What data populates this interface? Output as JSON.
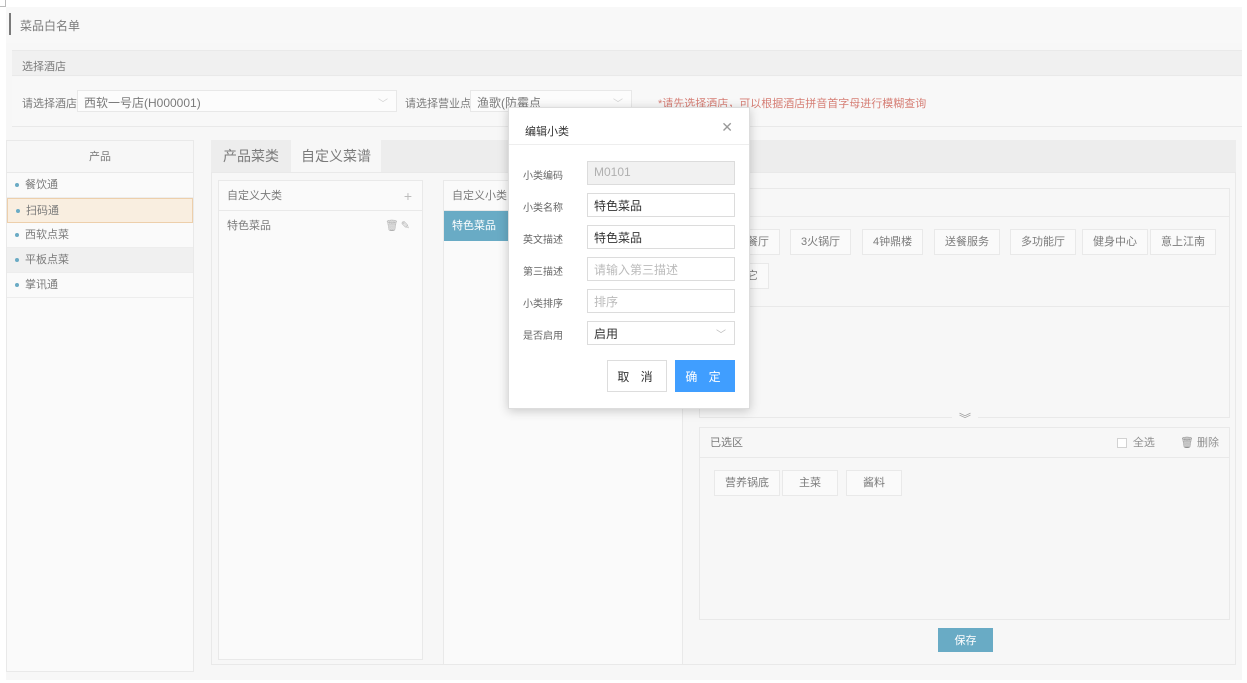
{
  "page_title": "菜品白名单",
  "section_select_hotel": "选择酒店",
  "filters": {
    "hotel_label": "请选择酒店",
    "hotel_value": "西软一号店(H000001)",
    "outlet_label": "请选择营业点",
    "outlet_value": "渔歌(防霉点",
    "hint": "*请先选择酒店，可以根据酒店拼音首字母进行模糊查询"
  },
  "left_panel": {
    "header": "产品",
    "items": [
      "餐饮通",
      "扫码通",
      "西软点菜",
      "平板点菜",
      "掌讯通"
    ]
  },
  "tabs": [
    "产品菜类",
    "自定义菜谱"
  ],
  "col1": {
    "header": "自定义大类",
    "rows": [
      "特色菜品"
    ]
  },
  "col2": {
    "header": "自定义小类",
    "selected": "特色菜品"
  },
  "chips": [
    "餐厅",
    "3火锅厅",
    "4钟鼎楼",
    "送餐服务",
    "多功能厅",
    "健身中心",
    "意上江南",
    "它"
  ],
  "picked": {
    "title": "已选区",
    "select_all": "全选",
    "delete": "删除",
    "chips": [
      "营养锅底",
      "主菜",
      "酱料"
    ]
  },
  "save_label": "保存",
  "dialog": {
    "title": "编辑小类",
    "fields": [
      {
        "label": "小类编码",
        "value": "M0101"
      },
      {
        "label": "小类名称",
        "value": "特色菜品"
      },
      {
        "label": "英文描述",
        "value": "特色菜品"
      },
      {
        "label": "第三描述",
        "placeholder": "请输入第三描述"
      },
      {
        "label": "小类排序",
        "placeholder": "排序"
      },
      {
        "label": "是否启用",
        "value": "启用"
      }
    ],
    "cancel": "取 消",
    "ok": "确 定"
  }
}
